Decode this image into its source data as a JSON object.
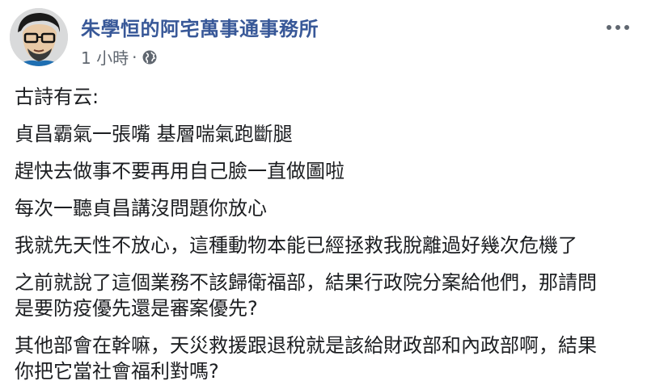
{
  "post": {
    "author": "朱學恒的阿宅萬事通事務所",
    "time": "1 小時",
    "separator": "·",
    "privacy_icon": "globe-icon",
    "more_icon": "more-options-icon",
    "paragraphs": [
      "古詩有云:",
      "貞昌霸氣一張嘴 基層喘氣跑斷腿",
      "趕快去做事不要再用自己臉一直做圖啦",
      "每次一聽貞昌講沒問題你放心",
      "我就先天性不放心，這種動物本能已經拯救我脫離過好幾次危機了",
      "之前就說了這個業務不該歸衛福部，結果行政院分案給他們，那請問\n是要防疫優先還是審案優先?",
      "其他部會在幹嘛，天災救援跟退稅就是該給財政部和內政部啊，結果\n你把它當社會福利對嗎?"
    ]
  },
  "colors": {
    "author_link": "#385898",
    "meta_text": "#606770",
    "body_text": "#1c1e21"
  }
}
